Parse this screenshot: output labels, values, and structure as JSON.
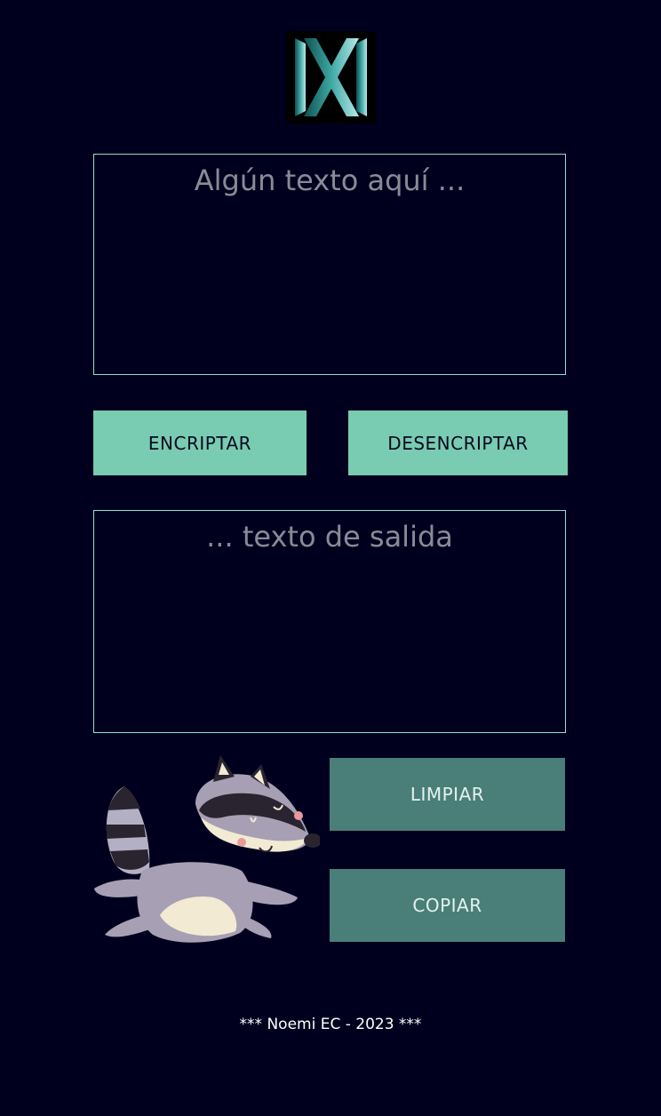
{
  "logo": {
    "icon": "x-logo-icon"
  },
  "input": {
    "placeholder": "Algún texto aquí ..."
  },
  "buttons": {
    "encrypt": "ENCRIPTAR",
    "decrypt": "DESENCRIPTAR",
    "clear": "LIMPIAR",
    "copy": "COPIAR"
  },
  "output": {
    "placeholder": "... texto de salida"
  },
  "illustration": {
    "icon": "raccoon-illustration"
  },
  "footer": {
    "text": "*** Noemi EC - 2023 ***"
  },
  "colors": {
    "background": "#00001e",
    "primary_button": "#79cbb1",
    "secondary_button": "#4a7e78",
    "textbox_border": "#8fe0d0"
  }
}
